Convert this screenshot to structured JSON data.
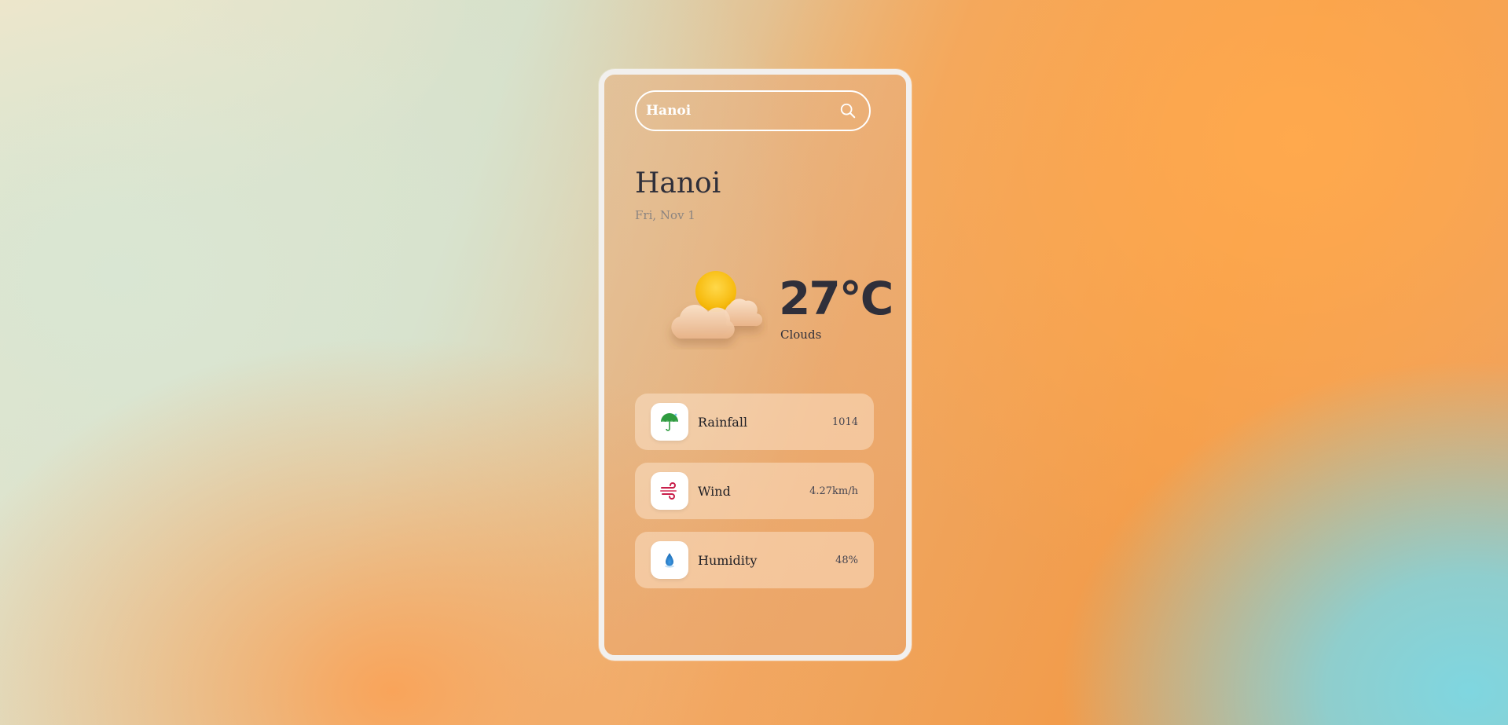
{
  "search": {
    "value": "Hanoi",
    "icon": "search-icon"
  },
  "location": {
    "city": "Hanoi",
    "date": "Fri, Nov 1"
  },
  "current": {
    "temperature": "27°C",
    "condition": "Clouds",
    "icon": "partly-cloudy-icon"
  },
  "stats": [
    {
      "label": "Rainfall",
      "value": "1014",
      "icon": "umbrella-icon"
    },
    {
      "label": "Wind",
      "value": "4.27km/h",
      "icon": "wind-icon"
    },
    {
      "label": "Humidity",
      "value": "48%",
      "icon": "droplet-icon"
    }
  ],
  "colors": {
    "text_dark": "#2f2f3a",
    "date_gray": "#8b8480",
    "sun_yellow": "#ffc400",
    "humidity_blue": "#2a86d4",
    "wind_red": "#c81e4a",
    "umbrella_green": "#2e9b3f"
  }
}
